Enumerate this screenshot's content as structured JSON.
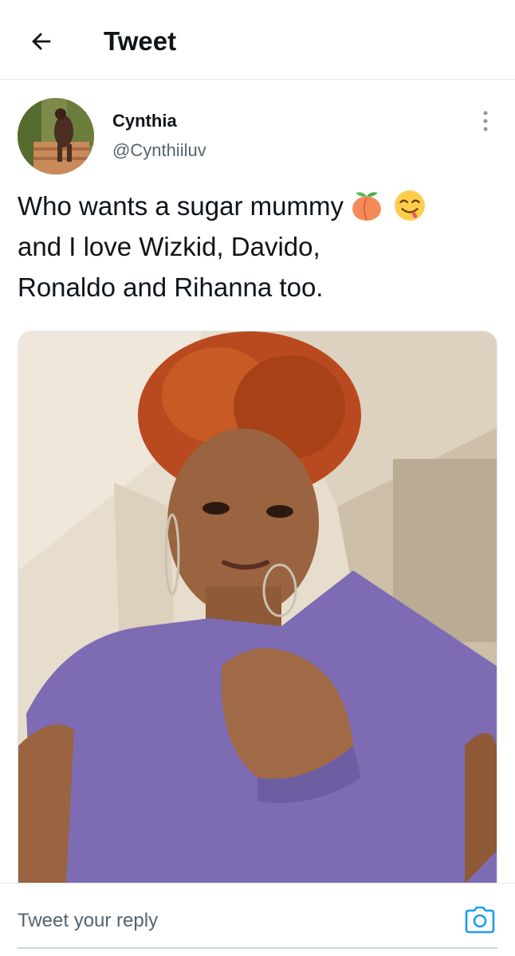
{
  "header": {
    "title": "Tweet",
    "back_icon": "arrow-left-icon"
  },
  "tweet": {
    "author": {
      "display_name": "Cynthia",
      "handle": "@Cynthiiluv"
    },
    "text_line1": "Who wants a sugar mummy",
    "emojis": [
      "peach-emoji",
      "face-savoring-food-emoji"
    ],
    "text_line2": "and I love Wizkid, Davido,",
    "text_line3": "Ronaldo and Rihanna too.",
    "more_icon": "vertical-ellipsis-icon"
  },
  "reply": {
    "placeholder": "Tweet your reply",
    "camera_icon": "camera-icon"
  },
  "colors": {
    "text": "#0f1419",
    "secondary": "#536471",
    "accent": "#1d9bf0",
    "divider": "#e6e6e6"
  }
}
